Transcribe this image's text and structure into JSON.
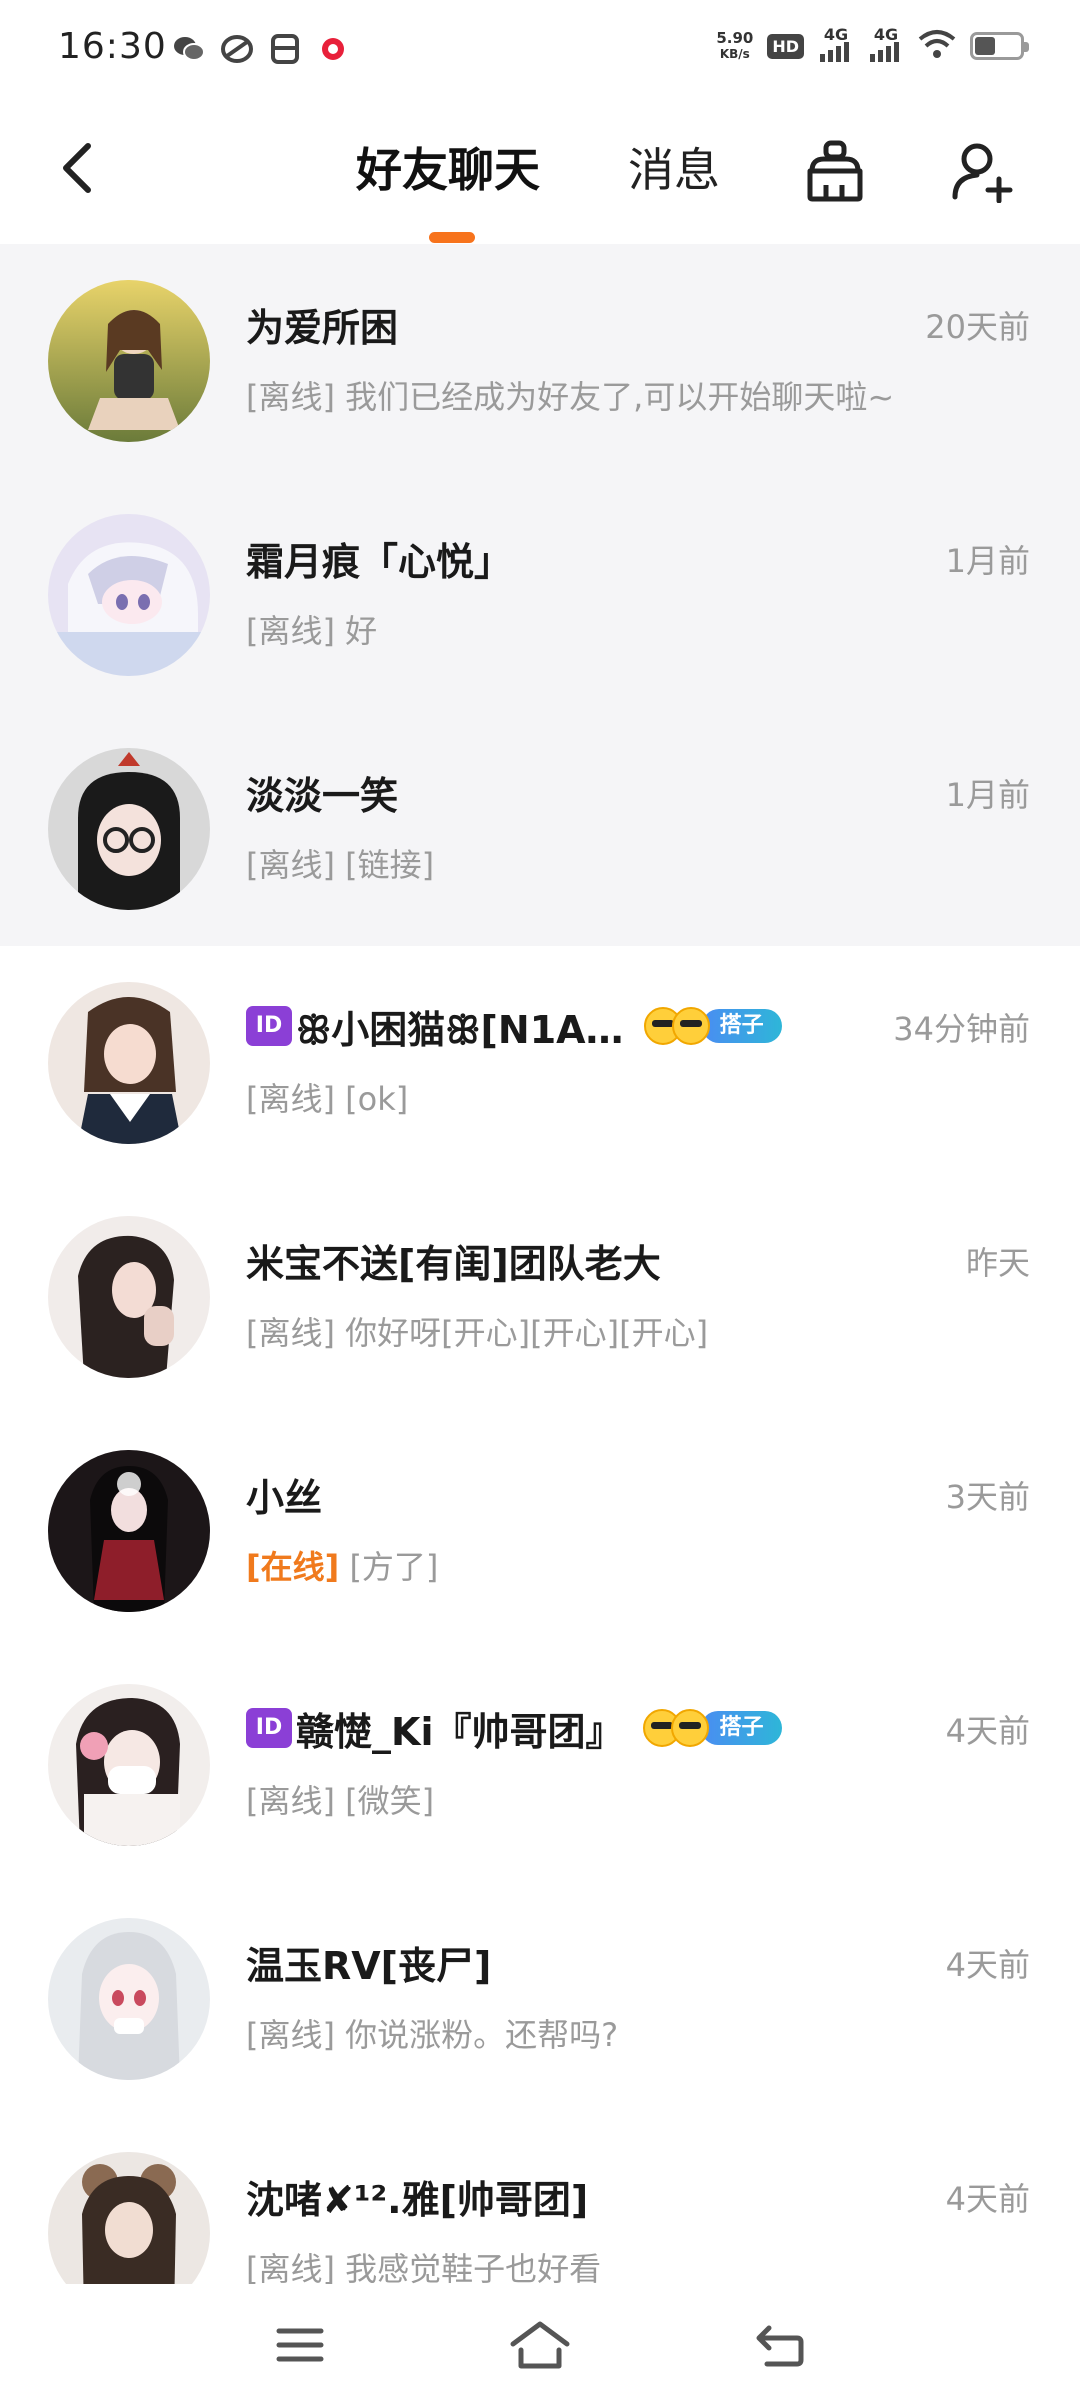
{
  "status_bar": {
    "time": "16:30",
    "net_speed": "5.90",
    "net_speed_unit": "KB/s",
    "hd_label": "HD",
    "signal1": "4G",
    "signal2": "4G",
    "icons": [
      "wechat-icon",
      "cloud-icon",
      "card-icon",
      "record-icon",
      "wifi-icon",
      "battery-icon"
    ]
  },
  "header": {
    "tabs": [
      {
        "label": "好友聊天",
        "active": true
      },
      {
        "label": "消息",
        "active": false
      }
    ],
    "accent_color": "#f7731c",
    "icons": [
      "back-arrow-icon",
      "broom-icon",
      "add-friend-icon"
    ]
  },
  "chats": [
    {
      "name": "为爱所困",
      "time": "20天前",
      "status": "[离线]",
      "online": false,
      "message": "我们已经成为好友了,可以开始聊天啦~",
      "pinned": true
    },
    {
      "name": "霜月痕「心悦」",
      "time": "1月前",
      "status": "[离线]",
      "online": false,
      "message": "好",
      "pinned": true
    },
    {
      "name": "淡淡一笑",
      "time": "1月前",
      "status": "[离线]",
      "online": false,
      "message": "[链接]",
      "pinned": true
    },
    {
      "id_badge": "ID",
      "name": "ꕥ小困猫ꕥ[N1A…",
      "badge": "搭子",
      "time": "34分钟前",
      "status": "[离线]",
      "online": false,
      "message": "[ok]",
      "pinned": false
    },
    {
      "name": "米宝不送[有闺]团队老大",
      "time": "昨天",
      "status": "[离线]",
      "online": false,
      "message": "你好呀[开心][开心][开心]",
      "pinned": false
    },
    {
      "name": "小丝",
      "time": "3天前",
      "status": "[在线]",
      "online": true,
      "message": "[方了]",
      "pinned": false
    },
    {
      "id_badge": "ID",
      "name": "赣憷_Ki『帅哥团』",
      "badge": "搭子",
      "time": "4天前",
      "status": "[离线]",
      "online": false,
      "message": "[微笑]",
      "pinned": false
    },
    {
      "name": "温玉RV[丧尸]",
      "time": "4天前",
      "status": "[离线]",
      "online": false,
      "message": "你说涨粉。还帮吗?",
      "pinned": false
    },
    {
      "name": "沈啫✘¹².雅[帅哥团]",
      "time": "4天前",
      "status": "[离线]",
      "online": false,
      "message": "我感觉鞋子也好看",
      "pinned": false
    }
  ],
  "nav_bar": {
    "icons": [
      "menu-icon",
      "home-icon",
      "return-icon"
    ]
  }
}
